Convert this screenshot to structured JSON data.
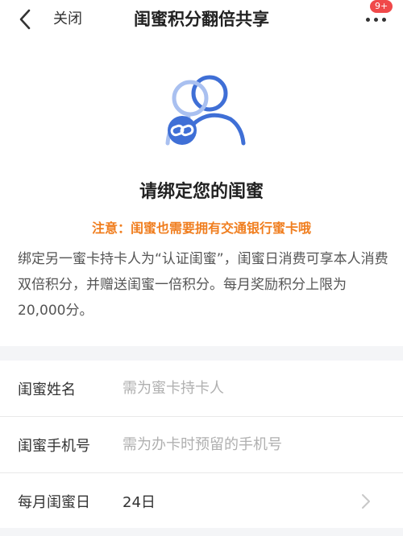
{
  "header": {
    "close_label": "关闭",
    "title": "闺蜜积分翻倍共享",
    "badge": "9+"
  },
  "icons": {
    "back": "chevron-left-icon",
    "more": "more-dots-icon",
    "illustration": "friends-link-icon",
    "row_arrow": "chevron-right-icon"
  },
  "colors": {
    "accent_blue": "#3f6fd6",
    "notice_orange": "#f07e1f",
    "badge_red": "#f0494a"
  },
  "main": {
    "heading": "请绑定您的闺蜜",
    "notice": "注意：闺蜜也需要拥有交通银行蜜卡哦",
    "description": "绑定另一蜜卡持卡人为“认证闺蜜”，闺蜜日消费可享本人消费双倍积分，并赠送闺蜜一倍积分。每月奖励积分上限为20,000分。"
  },
  "form": {
    "name_label": "闺蜜姓名",
    "name_placeholder": "需为蜜卡持卡人",
    "phone_label": "闺蜜手机号",
    "phone_placeholder": "需为办卡时预留的手机号",
    "day_label": "每月闺蜜日",
    "day_value": "24日"
  }
}
